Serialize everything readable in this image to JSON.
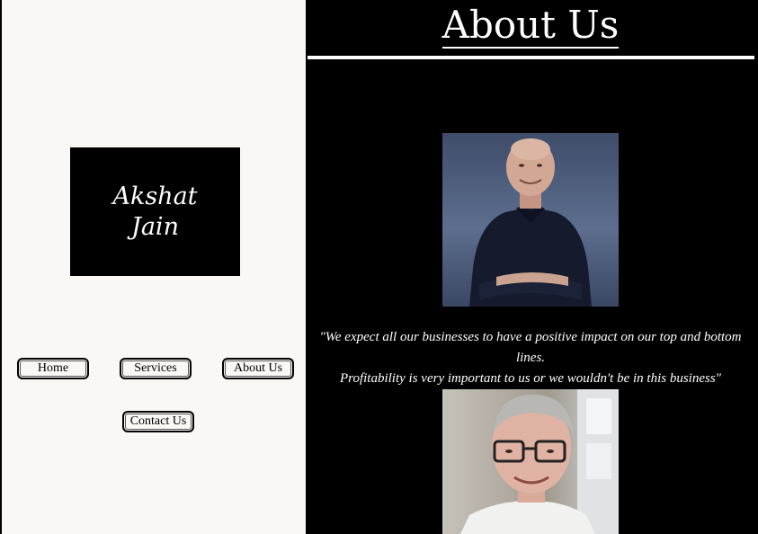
{
  "sidebar": {
    "logo_line1": "Akshat",
    "logo_line2": "Jain",
    "nav": {
      "home": "Home",
      "services": "Services",
      "about": "About Us",
      "contact": "Contact Us"
    }
  },
  "main": {
    "title": "About Us",
    "quote_line1": "\"We expect all our businesses to have a positive impact on our top and bottom lines.",
    "quote_line2": "Profitability is very important to us or we wouldn't be in this business\""
  },
  "colors": {
    "left_bg": "#fbf7f4",
    "right_bg": "#000000",
    "text_light": "#ffffff"
  }
}
